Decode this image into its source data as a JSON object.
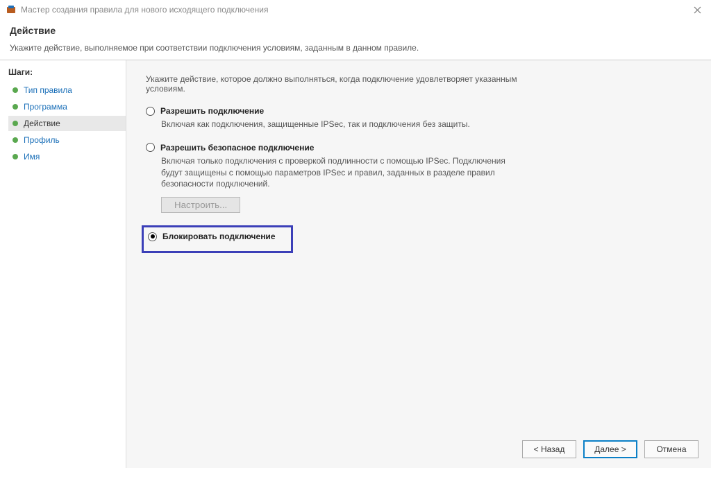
{
  "window": {
    "title": "Мастер создания правила для нового исходящего подключения"
  },
  "header": {
    "title": "Действие",
    "description": "Укажите действие, выполняемое при соответствии подключения условиям, заданным в данном правиле."
  },
  "sidebar": {
    "title": "Шаги:",
    "steps": [
      {
        "label": "Тип правила",
        "current": false
      },
      {
        "label": "Программа",
        "current": false
      },
      {
        "label": "Действие",
        "current": true
      },
      {
        "label": "Профиль",
        "current": false
      },
      {
        "label": "Имя",
        "current": false
      }
    ]
  },
  "main": {
    "instruction": "Укажите действие, которое должно выполняться, когда подключение удовлетворяет указанным условиям.",
    "options": {
      "allow": {
        "label": "Разрешить подключение",
        "desc": "Включая как подключения, защищенные IPSec, так и подключения без защиты."
      },
      "allow_secure": {
        "label": "Разрешить безопасное подключение",
        "desc": "Включая только подключения с проверкой подлинности с помощью IPSec. Подключения будут защищены с помощью параметров IPSec и правил, заданных в разделе правил безопасности подключений.",
        "configure": "Настроить..."
      },
      "block": {
        "label": "Блокировать подключение"
      }
    }
  },
  "footer": {
    "back": "< Назад",
    "next": "Далее >",
    "cancel": "Отмена"
  }
}
